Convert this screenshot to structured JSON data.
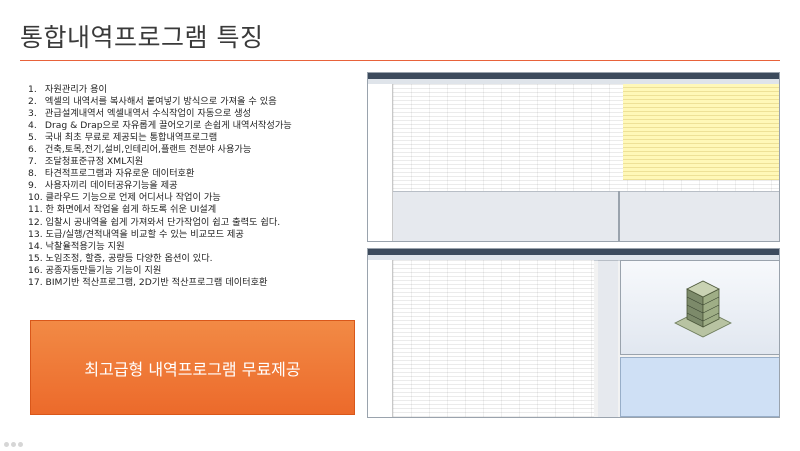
{
  "slide": {
    "title": "통합내역프로그램 특징",
    "features": [
      {
        "num": "1.",
        "text": "자원관리가 용이"
      },
      {
        "num": "2.",
        "text": "엑셀의 내역서를 복사해서 붙여넣기 방식으로 가져올 수 있음"
      },
      {
        "num": "3.",
        "text": "관급설계내역서 엑셀내역서 수식작업이 자동으로 생성"
      },
      {
        "num": "4.",
        "text": "Drag & Drap으로 자유롭게 끌어오기로 손쉽게 내역서작성가능"
      },
      {
        "num": "5.",
        "text": "국내 최초 무료로 제공되는 통합내역프로그램"
      },
      {
        "num": "6.",
        "text": "건축,토목,전기,설비,인테리어,플랜트 전분야 사용가능"
      },
      {
        "num": "7.",
        "text": "조달청표준규정 XML지원"
      },
      {
        "num": "8.",
        "text": "타견적프로그램과 자유로운 데이터호환"
      },
      {
        "num": "9.",
        "text": "사용자끼리 데이터공유기능을 제공"
      },
      {
        "num": "10.",
        "text": "클라우드 기능으로 언제 어디서나 작업이 가능"
      },
      {
        "num": "11.",
        "text": "한 화면에서 작업을 쉽게 하도록 쉬운 UI설계"
      },
      {
        "num": "12.",
        "text": "입찰시 공내역을 쉽게 가져와서 단가작업이 쉽고 출력도 쉽다."
      },
      {
        "num": "13.",
        "text": "도급/실행/견적내역을 비교할 수 있는 비교모드 제공"
      },
      {
        "num": "14.",
        "text": "낙찰율적용기능 지원"
      },
      {
        "num": "15.",
        "text": "노임조정, 할증, 공량등 다양한 옵션이 있다."
      },
      {
        "num": "16.",
        "text": "공종자동만들기능 기능이 지원"
      },
      {
        "num": "17.",
        "text": "BIM기반 적산프로그램, 2D기반 적산프로그램 데이터호환"
      }
    ],
    "cta_label": "최고급형 내역프로그램 무료제공"
  },
  "colors": {
    "accent_line": "#e8623a",
    "cta_background": "#ee7a38",
    "title_text": "#3a3a3a"
  },
  "icons": {
    "building": "building-3d-icon"
  }
}
